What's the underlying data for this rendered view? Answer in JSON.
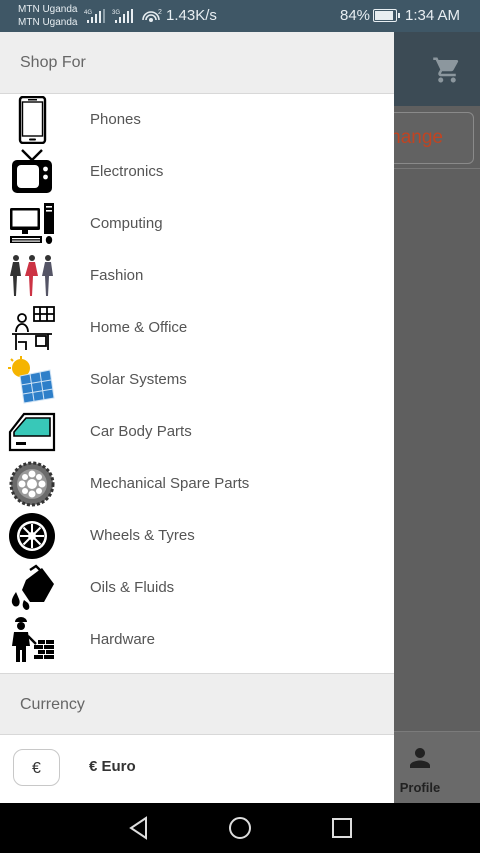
{
  "status_bar": {
    "carrier1": "MTN Uganda",
    "carrier2": "MTN Uganda",
    "net1": "4G",
    "net2": "3G",
    "speed": "1.43K/s",
    "battery": "84%",
    "battery_level": 0.84,
    "time": "1:34 AM"
  },
  "background": {
    "change_button": "Change",
    "profile_label": "Profile"
  },
  "drawer": {
    "shop_header": "Shop For",
    "categories": [
      {
        "label": "Phones",
        "icon": "phone-icon"
      },
      {
        "label": "Electronics",
        "icon": "tv-icon"
      },
      {
        "label": "Computing",
        "icon": "computer-icon"
      },
      {
        "label": "Fashion",
        "icon": "fashion-icon"
      },
      {
        "label": "Home & Office",
        "icon": "home-office-icon"
      },
      {
        "label": "Solar Systems",
        "icon": "solar-panel-icon"
      },
      {
        "label": "Car Body Parts",
        "icon": "car-door-icon"
      },
      {
        "label": "Mechanical Spare Parts",
        "icon": "gear-icon"
      },
      {
        "label": "Wheels & Tyres",
        "icon": "wheel-icon"
      },
      {
        "label": "Oils & Fluids",
        "icon": "oil-can-icon"
      },
      {
        "label": "Hardware",
        "icon": "builder-icon"
      }
    ],
    "currency_header": "Currency",
    "currency": {
      "symbol": "€",
      "name": "€ Euro"
    }
  },
  "colors": {
    "status_bar": "#3f5766",
    "accent": "#c04422",
    "drawer_header_bg": "#eeeeee",
    "scrim": "#5f5f5f"
  }
}
